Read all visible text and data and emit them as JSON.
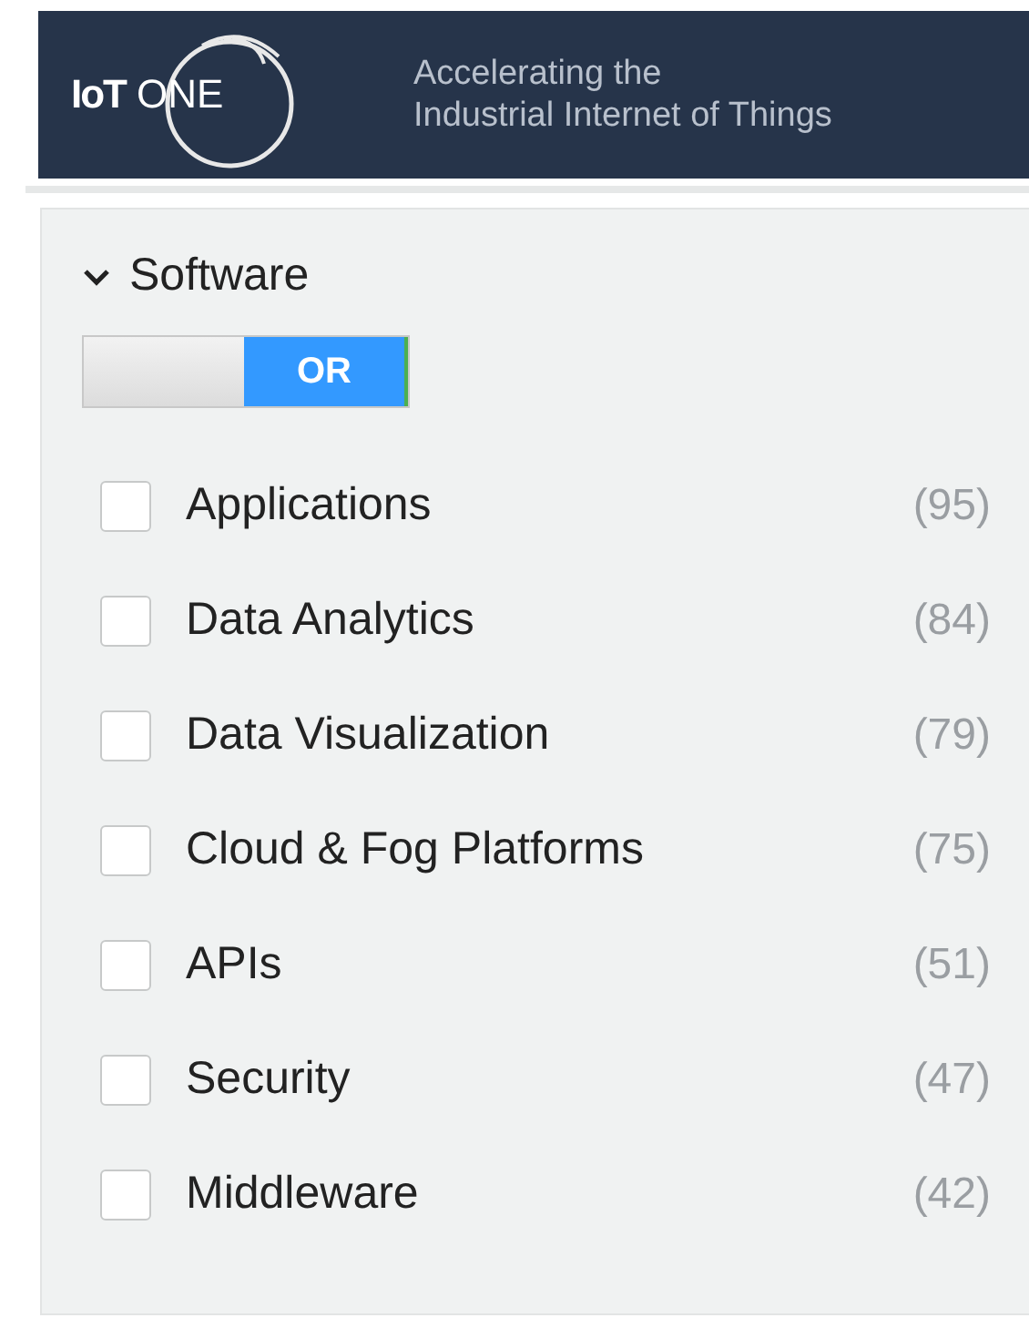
{
  "header": {
    "logo": {
      "left": "IoT",
      "right": "ONE"
    },
    "tagline": [
      "Accelerating the",
      "Industrial Internet of Things"
    ]
  },
  "filter": {
    "title": "Software",
    "expanded": true,
    "toggle": {
      "label": "OR",
      "on": true
    },
    "items": [
      {
        "label": "Applications",
        "count": "(95)",
        "checked": false
      },
      {
        "label": "Data Analytics",
        "count": "(84)",
        "checked": false
      },
      {
        "label": "Data Visualization",
        "count": "(79)",
        "checked": false
      },
      {
        "label": "Cloud & Fog Platforms",
        "count": "(75)",
        "checked": false
      },
      {
        "label": "APIs",
        "count": "(51)",
        "checked": false
      },
      {
        "label": "Security",
        "count": "(47)",
        "checked": false
      },
      {
        "label": "Middleware",
        "count": "(42)",
        "checked": false
      }
    ]
  }
}
